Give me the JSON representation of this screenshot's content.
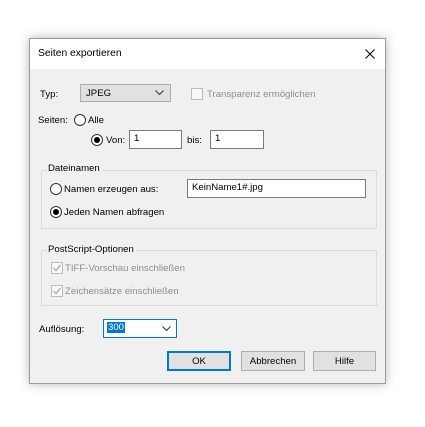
{
  "dialog": {
    "title": "Seiten exportieren",
    "close_icon": "close-icon"
  },
  "type": {
    "label": "Typ:",
    "selected": "JPEG",
    "transparency_label": "Transparenz ermöglichen",
    "transparency_checked": false,
    "transparency_enabled": false
  },
  "pages": {
    "label": "Seiten:",
    "all_label": "Alle",
    "all_selected": false,
    "from_label": "Von:",
    "from_selected": true,
    "from_value": "1",
    "to_label": "bis:",
    "to_value": "1"
  },
  "filenames": {
    "group_title": "Dateinamen",
    "generate_label": "Namen erzeugen aus:",
    "generate_selected": false,
    "pattern_value": "KeinName1#.jpg",
    "ask_label": "Jeden Namen abfragen",
    "ask_selected": true
  },
  "postscript": {
    "group_title": "PostScript-Optionen",
    "tiff_label": "TIFF-Vorschau einschließen",
    "tiff_checked": true,
    "fonts_label": "Zeichensätze einschließen",
    "fonts_checked": true,
    "enabled": false
  },
  "resolution": {
    "label": "Auflösung:",
    "selected": "300"
  },
  "buttons": {
    "ok": "OK",
    "cancel": "Abbrechen",
    "help": "Hilfe"
  },
  "colors": {
    "accent": "#0078d7",
    "dialog_bg": "#f0f0f0",
    "disabled_text": "#8d8d8d"
  }
}
